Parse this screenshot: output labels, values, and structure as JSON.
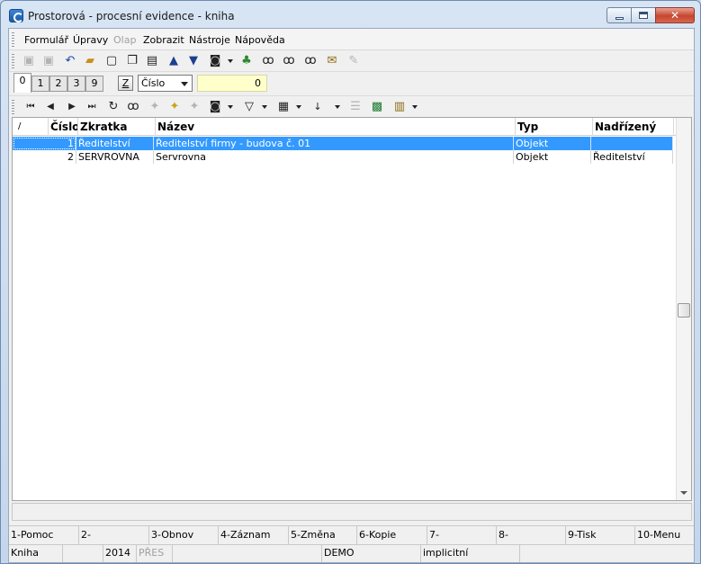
{
  "window": {
    "title": "Prostorová - procesní evidence - kniha"
  },
  "menu": [
    "Formulář",
    "Úpravy",
    "Olap",
    "Zobrazit",
    "Nástroje",
    "Nápověda"
  ],
  "tabs": [
    "0",
    "1",
    "2",
    "3",
    "9"
  ],
  "sort": {
    "z_label": "Z",
    "field": "Číslo",
    "search_value": "0"
  },
  "table": {
    "sort_marker": "/",
    "columns": [
      "Číslo",
      "Zkratka",
      "Název",
      "Typ",
      "Nadřízený"
    ],
    "rows": [
      {
        "cislo": "1",
        "zkratka": "Ředitelství",
        "nazev": "Ředitelství firmy - budova č. 01",
        "typ": "Objekt",
        "nadrizeny": ""
      },
      {
        "cislo": "2",
        "zkratka": "SERVROVNA",
        "nazev": "Servrovna",
        "typ": "Objekt",
        "nadrizeny": "Ředitelství"
      }
    ],
    "selected_row": 0
  },
  "function_keys": [
    "1-Pomoc",
    "2-",
    "3-Obnov",
    "4-Záznam",
    "5-Změna",
    "6-Kopie",
    "7-",
    "8-",
    "9-Tisk",
    "10-Menu"
  ],
  "status": {
    "book": "Kniha",
    "year": "2014",
    "overwrite": "PŘES",
    "database": "DEMO",
    "mode": "implicitní"
  },
  "colors": {
    "selection": "#3399ff",
    "search_bg": "#ffffcc"
  },
  "icons": {
    "toolbar1": [
      "save-icon",
      "save-disabled-icon",
      "undo-icon",
      "open-folder-icon",
      "new-document-icon",
      "copy-icon",
      "book-icon",
      "arrow-up-icon",
      "arrow-down-icon",
      "camera-icon",
      "tree-icon",
      "binoculars-icon",
      "binoculars-next-icon",
      "binoculars-prev-icon",
      "mail-icon",
      "edit-disabled-icon"
    ],
    "toolbar2": [
      "first-record-icon",
      "prev-record-icon",
      "next-record-icon",
      "last-record-icon",
      "refresh-icon",
      "find-icon",
      "mark-disabled-icon",
      "add-mark-icon",
      "remove-mark-icon",
      "camera-icon",
      "filter-icon",
      "columns-icon",
      "sort-az-icon",
      "list-disabled-icon",
      "excel-icon",
      "report-icon"
    ]
  }
}
